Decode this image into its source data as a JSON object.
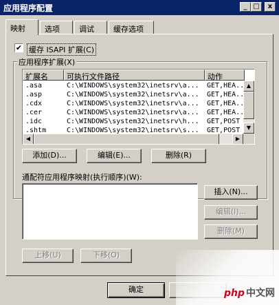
{
  "window": {
    "title": "应用程序配置"
  },
  "tabs": [
    {
      "label": "映射",
      "active": true
    },
    {
      "label": "选项",
      "active": false
    },
    {
      "label": "调试",
      "active": false
    },
    {
      "label": "缓存选项",
      "active": false
    }
  ],
  "cache_checkbox": {
    "label": "缓存 ISAPI 扩展(C)",
    "checked": true,
    "check_glyph": "✔"
  },
  "extensions_group": {
    "legend": "应用程序扩展(X)",
    "columns": [
      "扩展名",
      "可执行文件路径",
      "动作"
    ],
    "rows": [
      {
        "ext": ".asa",
        "path": "C:\\WINDOWS\\system32\\inetsrv\\a...",
        "verbs": "GET,HEA..."
      },
      {
        "ext": ".asp",
        "path": "C:\\WINDOWS\\system32\\inetsrv\\a...",
        "verbs": "GET,HEA..."
      },
      {
        "ext": ".cdx",
        "path": "C:\\WINDOWS\\system32\\inetsrv\\a...",
        "verbs": "GET,HEA..."
      },
      {
        "ext": ".cer",
        "path": "C:\\WINDOWS\\system32\\inetsrv\\a...",
        "verbs": "GET,HEA..."
      },
      {
        "ext": ".idc",
        "path": "C:\\WINDOWS\\system32\\inetsrv\\h...",
        "verbs": "GET,POST"
      },
      {
        "ext": ".shtm",
        "path": "C:\\WINDOWS\\system32\\inetsrv\\s...",
        "verbs": "GET,POST"
      }
    ],
    "add_button": "添加(D)...",
    "edit_button": "编辑(E)...",
    "remove_button": "删除(R)"
  },
  "wildcard": {
    "label": "通配符应用程序映射(执行顺序)(W):",
    "insert_button": "插入(N)...",
    "edit_button": "编辑(I)...",
    "remove_button": "删除(M)",
    "move_up_button": "上移(U)",
    "move_down_button": "下移(O)"
  },
  "footer": {
    "ok_button": "确定"
  },
  "watermark": {
    "brand": "php",
    "text": "中文网"
  },
  "glyphs": {
    "min": "_",
    "max": "□",
    "close": "x",
    "up": "▲",
    "down": "▼",
    "left": "◀",
    "right": "▶"
  }
}
